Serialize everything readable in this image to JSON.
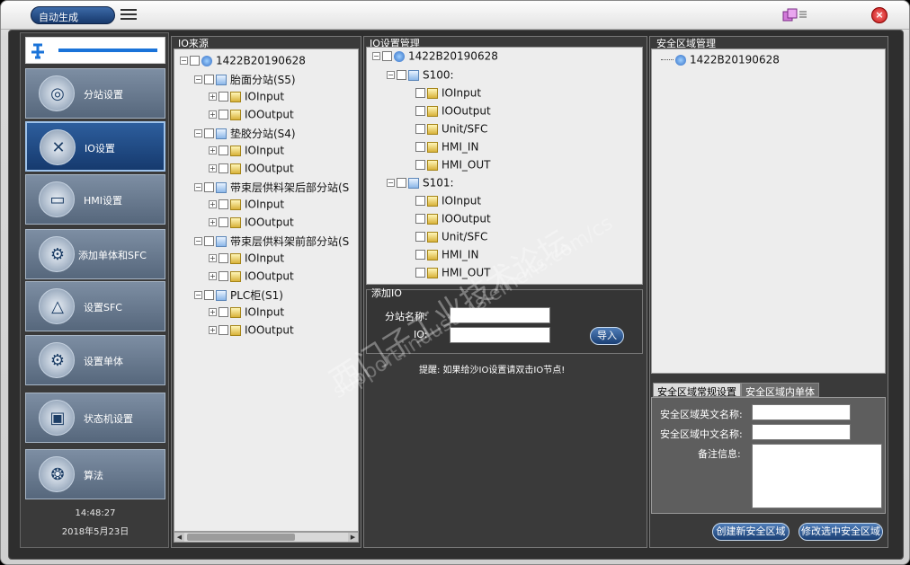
{
  "window": {
    "mode_button": "自动生成"
  },
  "sidebar": {
    "items": [
      {
        "label": "分站设置",
        "icon": "station-icon",
        "glyph": "◎"
      },
      {
        "label": "IO设置",
        "icon": "tools-icon",
        "glyph": "✕"
      },
      {
        "label": "HMI设置",
        "icon": "laptop-icon",
        "glyph": "▭"
      },
      {
        "label": "添加单体和SFC",
        "icon": "gears-icon",
        "glyph": "⚙"
      },
      {
        "label": "设置SFC",
        "icon": "compass-icon",
        "glyph": "△"
      },
      {
        "label": "设置单体",
        "icon": "chat-gear-icon",
        "glyph": "⚙"
      },
      {
        "label": "状态机设置",
        "icon": "machine-icon",
        "glyph": "▣"
      },
      {
        "label": "算法",
        "icon": "brain-icon",
        "glyph": "❂"
      }
    ],
    "time": "14:48:27",
    "date": "2018年5月23日"
  },
  "io_source": {
    "title": "IO来源",
    "root": "1422B20190628",
    "groups": [
      {
        "label": "胎面分站(S5)",
        "children": [
          "IOInput",
          "IOOutput"
        ]
      },
      {
        "label": "垫胶分站(S4)",
        "children": [
          "IOInput",
          "IOOutput"
        ]
      },
      {
        "label": "带束层供料架后部分站(S",
        "children": [
          "IOInput",
          "IOOutput"
        ]
      },
      {
        "label": "带束层供料架前部分站(S",
        "children": [
          "IOInput",
          "IOOutput"
        ]
      },
      {
        "label": "PLC柜(S1)",
        "children": [
          "IOInput",
          "IOOutput"
        ]
      }
    ]
  },
  "io_manage": {
    "title": "IO设置管理",
    "root": "1422B20190628",
    "groups": [
      {
        "label": "S100:",
        "children": [
          "IOInput",
          "IOOutput",
          "Unit/SFC",
          "HMI_IN",
          "HMI_OUT"
        ]
      },
      {
        "label": "S101:",
        "children": [
          "IOInput",
          "IOOutput",
          "Unit/SFC",
          "HMI_IN",
          "HMI_OUT"
        ]
      }
    ]
  },
  "add_io": {
    "title": "添加IO",
    "station_name_label": "分站名称:",
    "io_label": "IO:",
    "station_name_value": "",
    "io_value": "",
    "import_button": "导入",
    "hint": "提醒: 如果给沙IO设置请双击IO节点!"
  },
  "safety": {
    "title": "安全区域管理",
    "root": "1422B20190628",
    "tabs": [
      "安全区域常规设置",
      "安全区域内单体"
    ],
    "en_name_label": "安全区域英文名称:",
    "cn_name_label": "安全区域中文名称:",
    "remark_label": "备注信息:",
    "en_name_value": "",
    "cn_name_value": "",
    "remark_value": "",
    "create_button": "创建新安全区域",
    "modify_button": "修改选中安全区域"
  },
  "watermark": {
    "cn": "西门子工业技术论坛",
    "url": "support.industry.siemens.com/cs"
  }
}
